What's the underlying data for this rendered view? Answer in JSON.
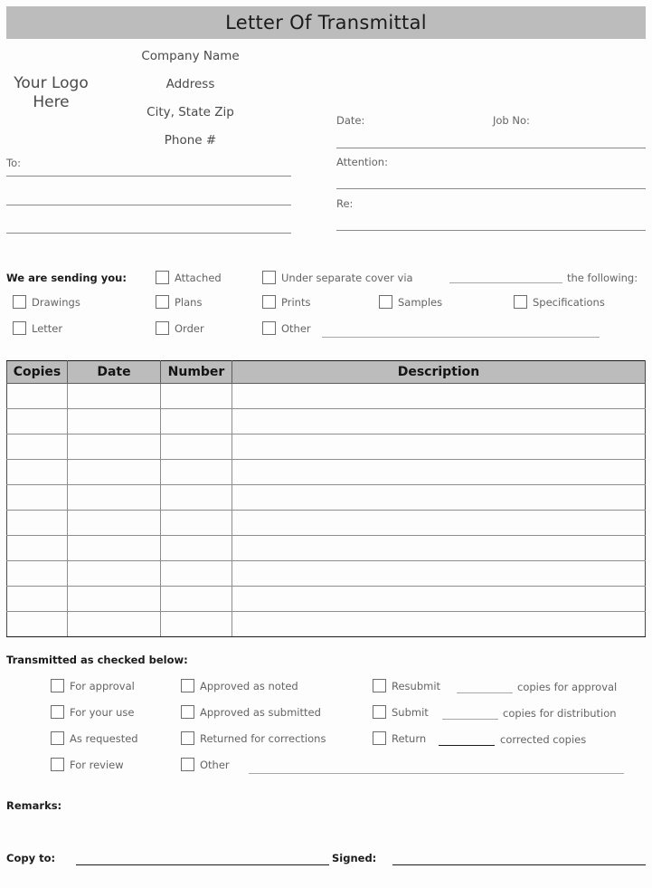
{
  "document": {
    "title": "Letter Of Transmittal"
  },
  "letterhead": {
    "logo_line1": "Your Logo",
    "logo_line2": "Here",
    "company_name": "Company Name",
    "address": "Address",
    "city_state_zip": "City, State  Zip",
    "phone": "Phone #"
  },
  "recipient": {
    "to_label": "To:"
  },
  "meta": {
    "date_label": "Date:",
    "job_no_label": "Job No:",
    "attention_label": "Attention:",
    "re_label": "Re:"
  },
  "sending": {
    "heading": "We are sending you:",
    "attached": "Attached",
    "under_separate_cover": "Under separate cover via",
    "the_following": "the following:",
    "drawings": "Drawings",
    "plans": "Plans",
    "prints": "Prints",
    "samples": "Samples",
    "specifications": "Specifications",
    "letter": "Letter",
    "order": "Order",
    "other": "Other"
  },
  "table": {
    "columns": [
      "Copies",
      "Date",
      "Number",
      "Description"
    ],
    "row_count": 10
  },
  "transmitted": {
    "heading": "Transmitted as checked below:",
    "col1": [
      "For approval",
      "For your use",
      "As requested",
      "For review"
    ],
    "col2": [
      "Approved as noted",
      "Approved as submitted",
      "Returned for corrections",
      "Other"
    ],
    "col3": [
      {
        "label": "Resubmit",
        "suffix": "copies for approval"
      },
      {
        "label": "Submit",
        "suffix": "copies for distribution"
      },
      {
        "label": "Return",
        "suffix": "corrected copies"
      }
    ]
  },
  "footer": {
    "remarks_label": "Remarks:",
    "copy_to_label": "Copy to:",
    "signed_label": "Signed:"
  },
  "colors": {
    "header_gray": "#bcbcbc",
    "rule_gray": "#8a8a8a",
    "text_gray": "#646464",
    "text_dark": "#1c1c1c"
  }
}
